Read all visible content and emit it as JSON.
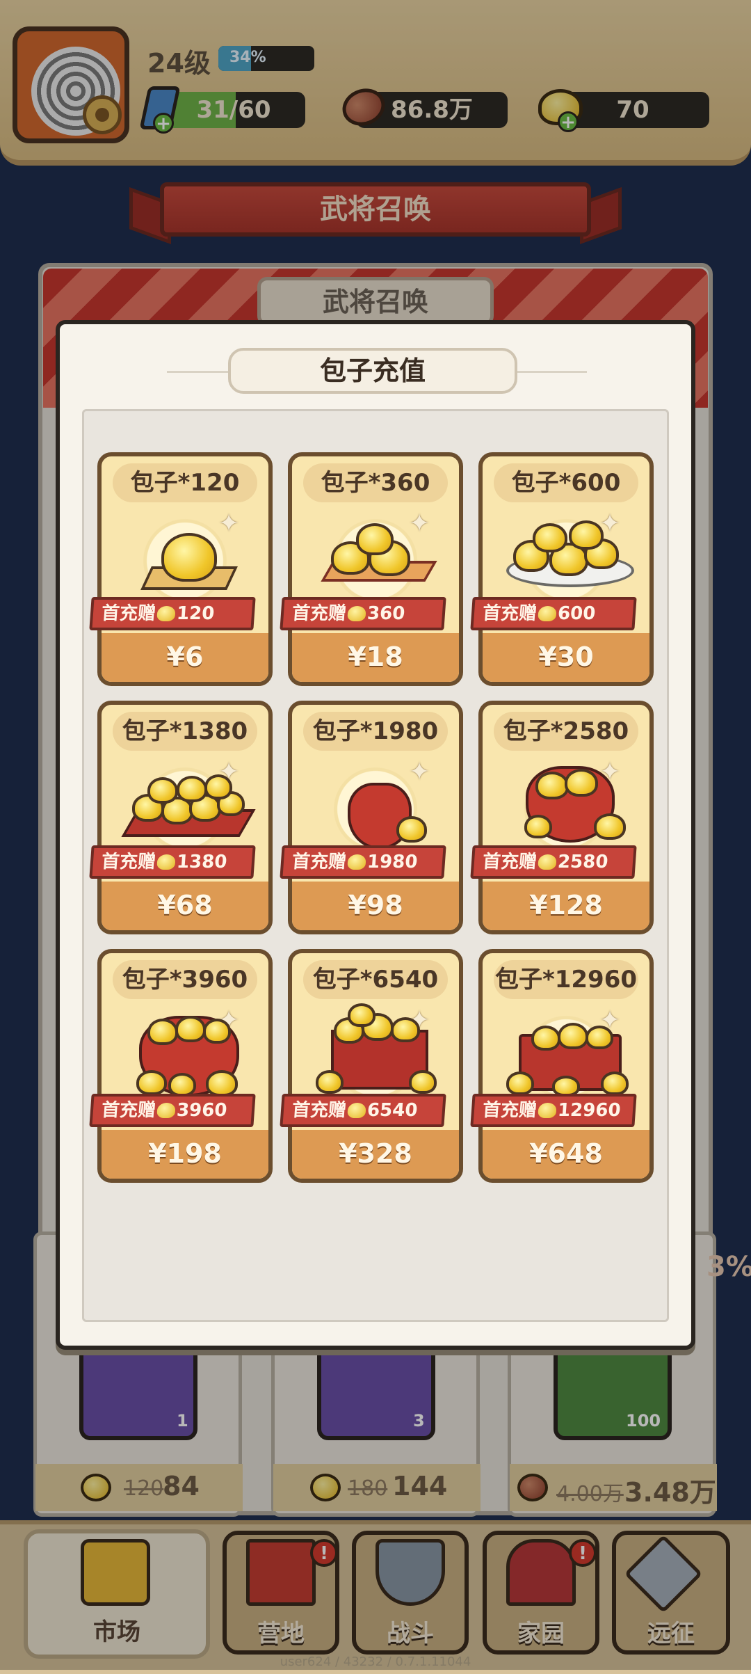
{
  "player": {
    "level_label": "24级",
    "xp_percent_label": "34%",
    "xp_fraction": 0.34
  },
  "resources": {
    "energy": {
      "value": "31/60",
      "fraction": 0.5167
    },
    "beans": {
      "value": "86.8万"
    },
    "buns": {
      "value": "70"
    }
  },
  "background": {
    "banner_title": "武将召唤",
    "panel_title": "武将召唤",
    "items": [
      {
        "count": "1",
        "old_price": "120",
        "new_price": "84"
      },
      {
        "count": "3",
        "old_price": "180",
        "new_price": "144"
      },
      {
        "count": "100",
        "old_price": "4.00万",
        "new_price": "3.48万"
      }
    ],
    "pct_badges": [
      "3%",
      "%"
    ]
  },
  "modal": {
    "title": "包子充值",
    "products": [
      {
        "name": "包子*120",
        "bonus_label": "首充赠",
        "bonus_amount": "120",
        "price": "¥6",
        "art": "single-bun"
      },
      {
        "name": "包子*360",
        "bonus_label": "首充赠",
        "bonus_amount": "360",
        "price": "¥18",
        "art": "bun-tray"
      },
      {
        "name": "包子*600",
        "bonus_label": "首充赠",
        "bonus_amount": "600",
        "price": "¥30",
        "art": "bun-plate"
      },
      {
        "name": "包子*1380",
        "bonus_label": "首充赠",
        "bonus_amount": "1380",
        "price": "¥68",
        "art": "bun-pile-tray"
      },
      {
        "name": "包子*1980",
        "bonus_label": "首充赠",
        "bonus_amount": "1980",
        "price": "¥98",
        "art": "bun-sack-small"
      },
      {
        "name": "包子*2580",
        "bonus_label": "首充赠",
        "bonus_amount": "2580",
        "price": "¥128",
        "art": "bun-sack-open"
      },
      {
        "name": "包子*3960",
        "bonus_label": "首充赠",
        "bonus_amount": "3960",
        "price": "¥198",
        "art": "bun-sack-large"
      },
      {
        "name": "包子*6540",
        "bonus_label": "首充赠",
        "bonus_amount": "6540",
        "price": "¥328",
        "art": "bun-crate"
      },
      {
        "name": "包子*12960",
        "bonus_label": "首充赠",
        "bonus_amount": "12960",
        "price": "¥648",
        "art": "bun-chest"
      }
    ]
  },
  "nav": {
    "items": [
      {
        "label": "市场",
        "active": true,
        "alert": false
      },
      {
        "label": "营地",
        "active": false,
        "alert": true
      },
      {
        "label": "战斗",
        "active": false,
        "alert": false
      },
      {
        "label": "家园",
        "active": false,
        "alert": true
      },
      {
        "label": "远征",
        "active": false,
        "alert": false
      }
    ]
  },
  "version": "user624 / 43232 / 0.7.1.11044",
  "colors": {
    "accent_red": "#c6443a",
    "card_bg": "#f9e6ae",
    "price_orange": "#dd9a53",
    "bun_yellow": "#f0c62a"
  }
}
